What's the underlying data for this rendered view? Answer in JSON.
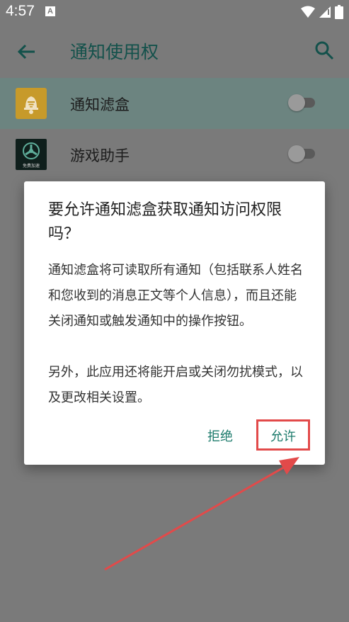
{
  "status_bar": {
    "time": "4:57",
    "notification_glyph": "A",
    "icons": [
      "wifi-icon",
      "signal-icon",
      "battery-icon"
    ]
  },
  "app_bar": {
    "title": "通知使用权",
    "back_icon": "arrow-back-icon",
    "search_icon": "search-icon"
  },
  "list": {
    "items": [
      {
        "label": "通知滤盒",
        "icon": "bell-filter-icon",
        "enabled": false,
        "highlighted": true
      },
      {
        "label": "游戏助手",
        "icon": "game-helper-icon",
        "icon_caption": "免费加速",
        "enabled": false,
        "highlighted": false
      }
    ]
  },
  "dialog": {
    "title": "要允许通知滤盒获取通知访问权限吗？",
    "body_1": "通知滤盒将可读取所有通知（包括联系人姓名和您收到的消息正文等个人信息），而且还能关闭通知或触发通知中的操作按钮。",
    "body_2": "另外，此应用还将能开启或关闭勿扰模式，以及更改相关设置。",
    "deny_label": "拒绝",
    "allow_label": "允许"
  },
  "colors": {
    "accent": "#1b7a6b",
    "annotation": "#e24a4a",
    "scrim": "#7a7a7a"
  }
}
